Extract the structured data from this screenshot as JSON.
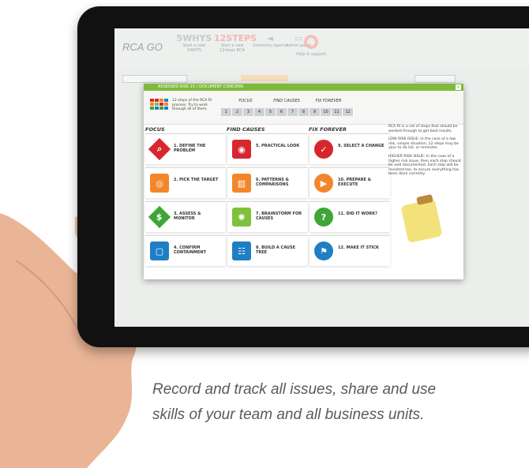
{
  "app": {
    "logo": "RCA GO",
    "tools": [
      {
        "big": "5WHYS",
        "label": "Start a new 5WHYS"
      },
      {
        "big": "12STEPS",
        "label": "Start a new 12steps RCA"
      },
      {
        "big": "",
        "label": "Summary reports"
      },
      {
        "big": "",
        "label": "Admin panel"
      },
      {
        "big": "",
        "label": "Help & support"
      }
    ]
  },
  "modal": {
    "title": "ASSESSED RISK 15 / DOCUMENT CONCERN",
    "close": "×",
    "description": "12 steps of the RCA RI process. Try to work through all of them.",
    "phases": [
      "FOCUS",
      "FIND CAUSES",
      "FIX FOREVER"
    ],
    "numbers": [
      "1",
      "2",
      "3",
      "4",
      "5",
      "6",
      "7",
      "8",
      "9",
      "10",
      "11",
      "12"
    ],
    "columns": [
      "FOCUS",
      "FIND CAUSES",
      "FIX FOREVER"
    ],
    "steps": [
      {
        "label": "1. DEFINE THE PROBLEM",
        "icon": "magnifier-icon",
        "glyph": "⌕",
        "color": "#d8262f"
      },
      {
        "label": "2. PICK THE TARGET",
        "icon": "target-icon",
        "glyph": "◎",
        "color": "#f3862a"
      },
      {
        "label": "3. ASSESS & MONITOR",
        "icon": "dollar-icon",
        "glyph": "$",
        "color": "#3da636"
      },
      {
        "label": "4. CONFIRM CONTAINMENT",
        "icon": "square-icon",
        "glyph": "▢",
        "color": "#1f7fc4"
      },
      {
        "label": "5. PRACTICAL LOOK",
        "icon": "eye-icon",
        "glyph": "◉",
        "color": "#d8262f"
      },
      {
        "label": "6. PATTERNS & COMPARISONS",
        "icon": "bar-chart-icon",
        "glyph": "▥",
        "color": "#f3862a"
      },
      {
        "label": "7. BRAINSTORM FOR CAUSES",
        "icon": "lightbulb-icon",
        "glyph": "✺",
        "color": "#7ec13c"
      },
      {
        "label": "8. BUILD A CAUSE TREE",
        "icon": "tree-icon",
        "glyph": "☷",
        "color": "#1f7fc4"
      },
      {
        "label": "9. SELECT A CHANGE",
        "icon": "check-icon",
        "glyph": "✓",
        "color": "#d8262f"
      },
      {
        "label": "10. PREPARE & EXECUTE",
        "icon": "play-icon",
        "glyph": "▶",
        "color": "#f3862a"
      },
      {
        "label": "11. DID IT WORK?",
        "icon": "question-icon",
        "glyph": "?",
        "color": "#3da636"
      },
      {
        "label": "12. MAKE IT STICK",
        "icon": "flag-icon",
        "glyph": "⚑",
        "color": "#1f7fc4"
      }
    ],
    "side_text": [
      "RCA RI is a set of steps that should be worked through to get best results.",
      "LOW RISK ISSUE: In the case of a low risk, simple situation, 12 steps may be your to do list, or reminder.",
      "HIGHER RISK ISSUE: In the case of a higher risk issue, then each step should be well documented. Each step will be revisited too, to ensure everything has been done correctly."
    ]
  },
  "caption": {
    "line1": "Record and track all issues, share and use",
    "line2": "skills of your team and all business units."
  }
}
